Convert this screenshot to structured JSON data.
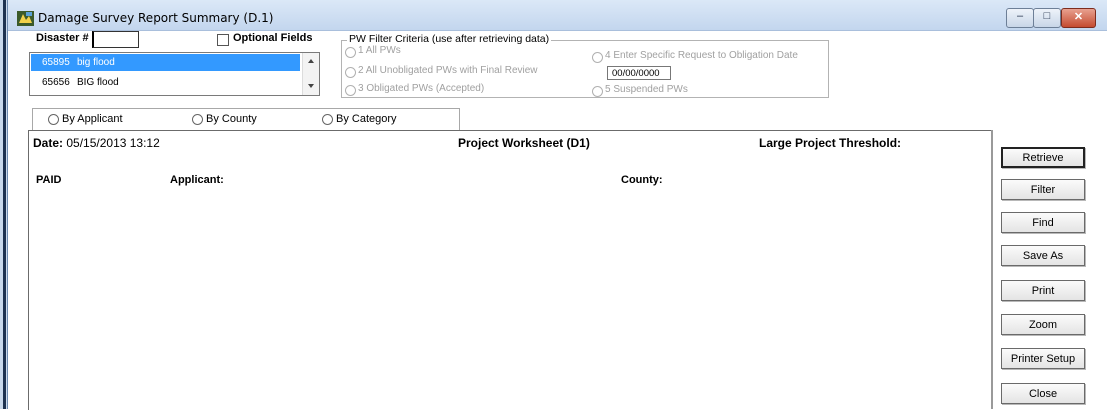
{
  "window": {
    "title": "Damage Survey Report Summary (D.1)"
  },
  "window_controls": {
    "minimize": "–",
    "maximize": "□",
    "close": "✕"
  },
  "disaster": {
    "label": "Disaster #",
    "value": ""
  },
  "optional_fields": {
    "label": "Optional Fields",
    "checked": false
  },
  "disaster_list": [
    {
      "number": "65895",
      "name": "big flood",
      "selected": true
    },
    {
      "number": "65656",
      "name": "BIG flood",
      "selected": false
    }
  ],
  "pw_filter": {
    "title": "PW Filter Criteria (use after retrieving data)",
    "options": [
      "1 All PWs",
      "2 All Unobligated PWs with Final Review",
      "3 Obligated PWs (Accepted)",
      "4 Enter Specific Request to Obligation Date",
      "5 Suspended PWs"
    ],
    "date_value": "00/00/0000"
  },
  "group_by": [
    "By Applicant",
    "By County",
    "By Category"
  ],
  "report": {
    "date_label": "Date:",
    "date_value": "05/15/2013 13:12",
    "title": "Project Worksheet (D1)",
    "threshold_label": "Large Project Threshold:",
    "columns": {
      "paid": "PAID",
      "applicant": "Applicant:",
      "county": "County:"
    }
  },
  "buttons": [
    "Retrieve",
    "Filter",
    "Find",
    "Save As",
    "Print",
    "Zoom",
    "Printer Setup",
    "Close"
  ]
}
